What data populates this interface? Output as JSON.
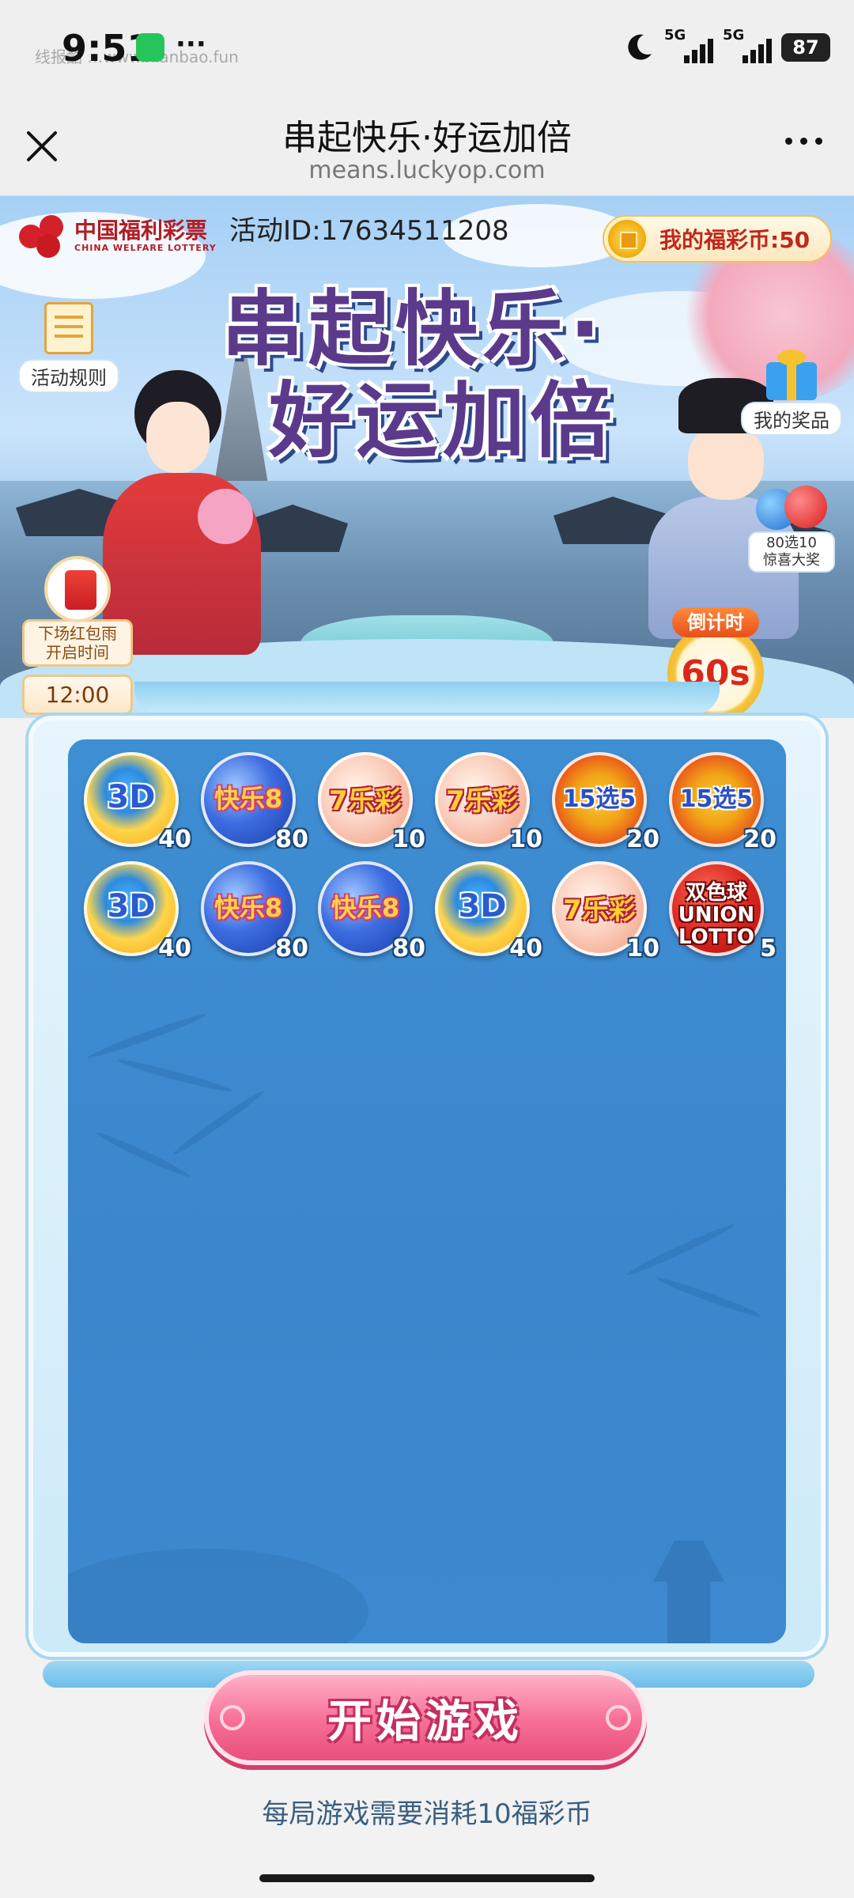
{
  "status_bar": {
    "time": "9:51",
    "watermark": "线报酷 …www.xianbao.fun",
    "dots": "···",
    "signal1_label": "5G",
    "signal2_label": "5G",
    "battery": "87"
  },
  "nav": {
    "title": "串起快乐·好运加倍",
    "subtitle": "means.luckyop.com"
  },
  "banner": {
    "logo_cn": "中国福利彩票",
    "logo_en": "CHINA WELFARE LOTTERY",
    "activity_id": "活动ID:17634511208",
    "coins_label": "我的福彩币:50",
    "title_line1": "串起快乐·",
    "title_line2": "好运加倍",
    "rules_label": "活动规则",
    "prizes_label": "我的奖品",
    "jackpot_line1": "80选10",
    "jackpot_line2": "惊喜大奖",
    "rain_line1": "下场红包雨",
    "rain_line2": "开启时间",
    "rain_time": "12:00",
    "countdown_label": "倒计时",
    "countdown_value": "60s"
  },
  "board": {
    "balls": [
      {
        "type": "t-3d",
        "label": "3D",
        "count": "40"
      },
      {
        "type": "t-kl",
        "label": "快乐8",
        "count": "80"
      },
      {
        "type": "t-7",
        "label": "7乐彩",
        "count": "10"
      },
      {
        "type": "t-7",
        "label": "7乐彩",
        "count": "10"
      },
      {
        "type": "t-15",
        "label": "15选5",
        "count": "20"
      },
      {
        "type": "t-15",
        "label": "15选5",
        "count": "20"
      },
      {
        "type": "t-3d",
        "label": "3D",
        "count": "40"
      },
      {
        "type": "t-kl",
        "label": "快乐8",
        "count": "80"
      },
      {
        "type": "t-kl",
        "label": "快乐8",
        "count": "80"
      },
      {
        "type": "t-3d",
        "label": "3D",
        "count": "40"
      },
      {
        "type": "t-7",
        "label": "7乐彩",
        "count": "10"
      },
      {
        "type": "t-ss",
        "label": "双色球 UNION LOTTO",
        "count": "5"
      }
    ]
  },
  "actions": {
    "start_label": "开始游戏",
    "cost_note": "每局游戏需要消耗10福彩币"
  },
  "colors": {
    "board_blue": "#3e8ed4",
    "start_button": "#f66e95",
    "countdown_red": "#d9281c"
  }
}
